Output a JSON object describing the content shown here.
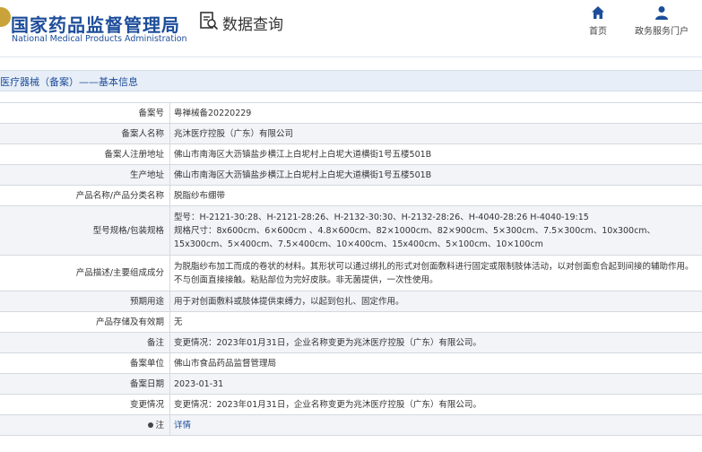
{
  "header": {
    "logo_cn": "国家药品监督管理局",
    "logo_en": "National Medical Products Administration",
    "query_label": "数据查询",
    "nav": [
      {
        "label": "首页",
        "icon": "home-icon"
      },
      {
        "label": "政务服务门户",
        "icon": "user-icon"
      }
    ]
  },
  "section_title": "医疗器械（备案）——基本信息",
  "colors": {
    "brand": "#1d4d9a",
    "emblem": "#c9a33a",
    "title_bg": "#e8eef7",
    "row_alt": "#f2f4f8",
    "border": "#d5d9e0"
  },
  "rows": [
    {
      "label": "备案号",
      "value": "粤禅械备20220229"
    },
    {
      "label": "备案人名称",
      "value": "兆沐医疗控股（广东）有限公司"
    },
    {
      "label": "备案人注册地址",
      "value": "佛山市南海区大沥镇盐步横江上白坭村上白坭大道横街1号五楼501B"
    },
    {
      "label": "生产地址",
      "value": "佛山市南海区大沥镇盐步横江上白坭村上白坭大道横街1号五楼501B"
    },
    {
      "label": "产品名称/产品分类名称",
      "value": "脱脂纱布绷带"
    },
    {
      "label": "型号规格/包装规格",
      "value_lines": [
        "型号：H-2121-30:28、H-2121-28:26、H-2132-30:30、H-2132-28:26、H-4040-28:26 H-4040-19:15",
        "规格尺寸：8x600cm、6×600cm 、4.8×600cm、82×1000cm、82×900cm、5×300cm、7.5×300cm、10x300cm、15x300cm、5×400cm、7.5×400cm、10×400cm、15x400cm、5×100cm、10×100cm"
      ]
    },
    {
      "label": "产品描述/主要组成成分",
      "value_lines": [
        "为脱脂纱布加工而成的卷状的材料。其形状可以通过绑扎的形式对创面敷料进行固定或限制肢体活动，以对创面愈合起到间接的辅助作用。不与创面直接接触。粘贴部位为完好皮肤。非无菌提供，一次性使用。"
      ]
    },
    {
      "label": "预期用途",
      "value": "用于对创面敷料或肢体提供束缚力，以起到包扎、固定作用。"
    },
    {
      "label": "产品存储及有效期",
      "value": "无"
    },
    {
      "label": "备注",
      "value": "变更情况：2023年01月31日，企业名称变更为兆沐医疗控股（广东）有限公司。"
    },
    {
      "label": "备案单位",
      "value": "佛山市食品药品监督管理局"
    },
    {
      "label": "备案日期",
      "value": "2023-01-31"
    },
    {
      "label": "变更情况",
      "value": "变更情况：2023年01月31日，企业名称变更为兆沐医疗控股（广东）有限公司。"
    },
    {
      "label": "注",
      "value": "详情"
    }
  ]
}
